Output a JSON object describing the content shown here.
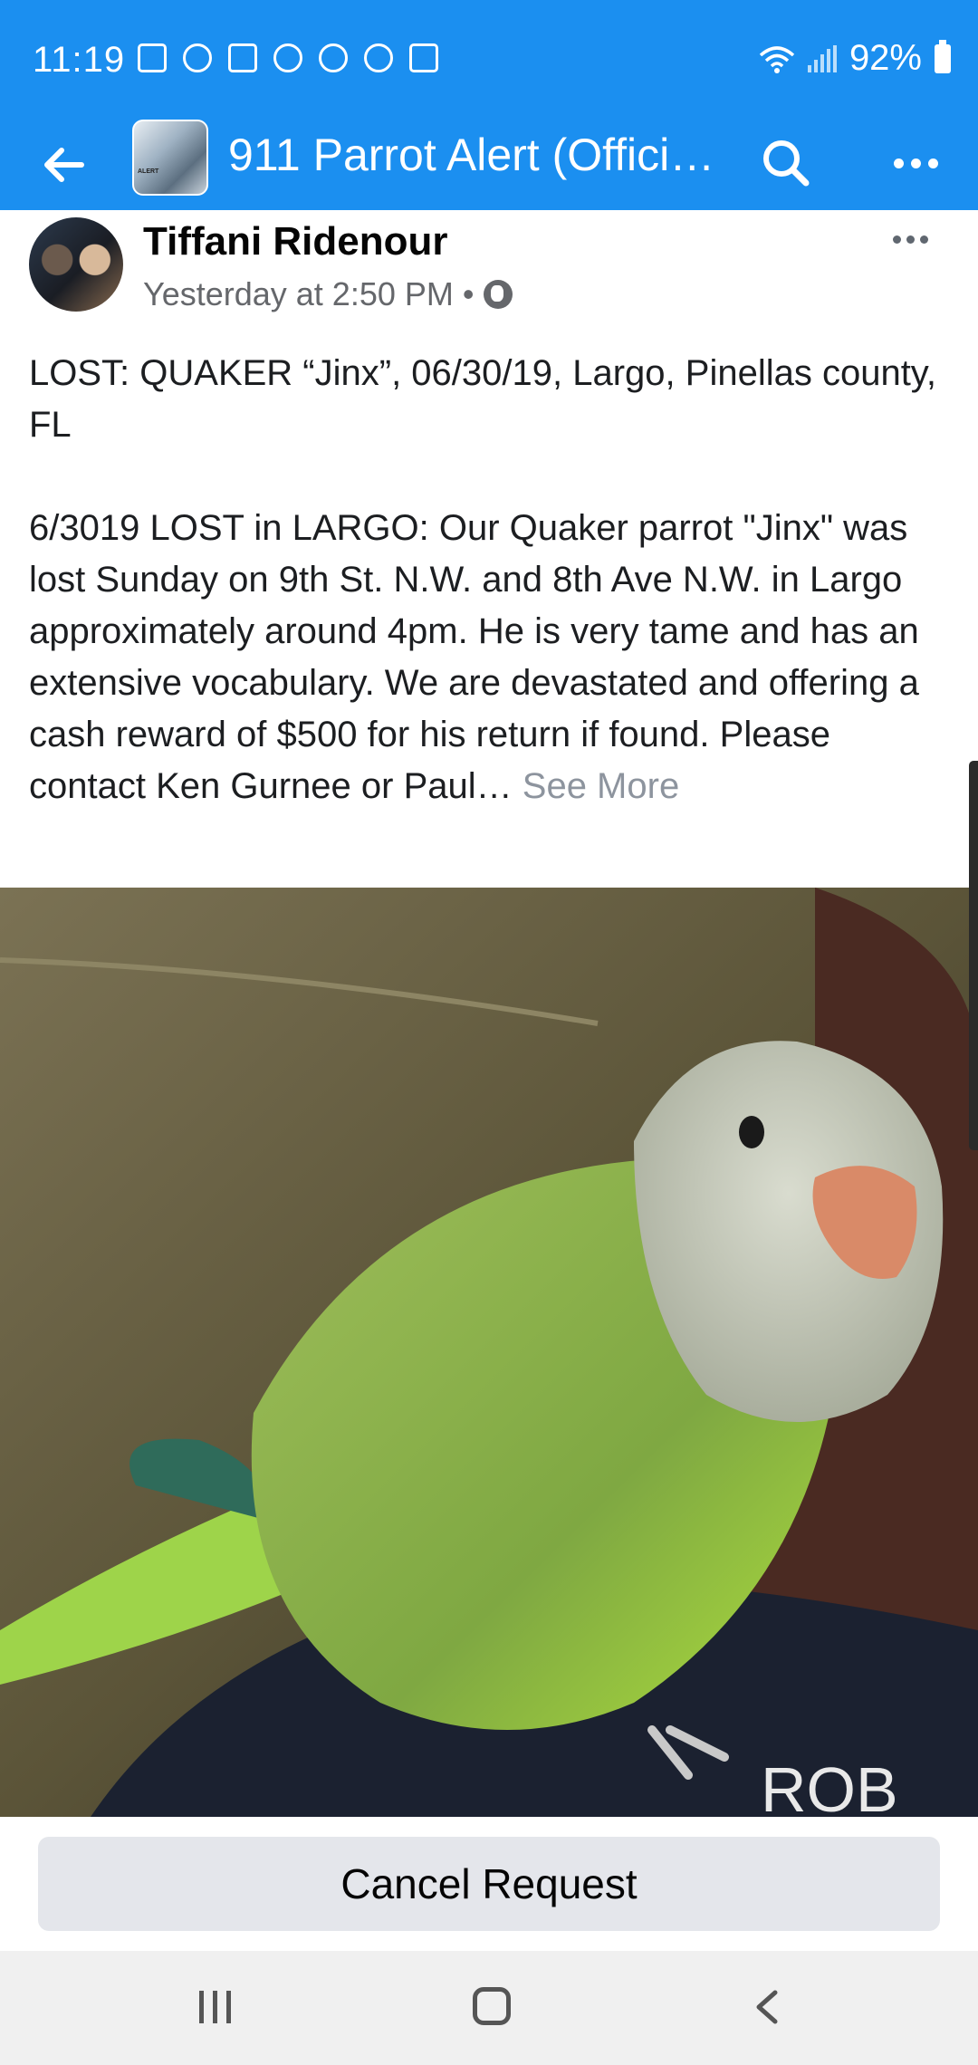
{
  "status_bar": {
    "time": "11:19",
    "battery": "92%"
  },
  "header": {
    "group_title": "911 Parrot Alert (Offici…",
    "thumb_caption": "ALERT"
  },
  "post": {
    "author": "Tiffani Ridenour",
    "timestamp": "Yesterday at 2:50 PM",
    "separator": "•",
    "title_line": "LOST: QUAKER “Jinx”, 06/30/19, Largo, Pinellas county, FL",
    "body": "6/3019 LOST in LARGO: Our Quaker parrot \"Jinx\" was lost Sunday on 9th St. N.W. and 8th Ave N.W. in Largo approximately around 4pm. He is very tame and has an extensive vocabulary. We are devastated and offering a cash reward of $500 for his return if found. Please contact Ken Gurnee or Paul…",
    "see_more": "See More",
    "photo_text": "ROB"
  },
  "actions": {
    "cancel_request": "Cancel Request"
  },
  "colors": {
    "header_bg": "#1b8ff0",
    "button_bg": "#e4e6eb",
    "meta_gray": "#65676b"
  },
  "icons": [
    "back-arrow-icon",
    "search-icon",
    "more-dots-icon",
    "globe-icon",
    "recents-icon",
    "home-icon",
    "nav-back-icon"
  ]
}
